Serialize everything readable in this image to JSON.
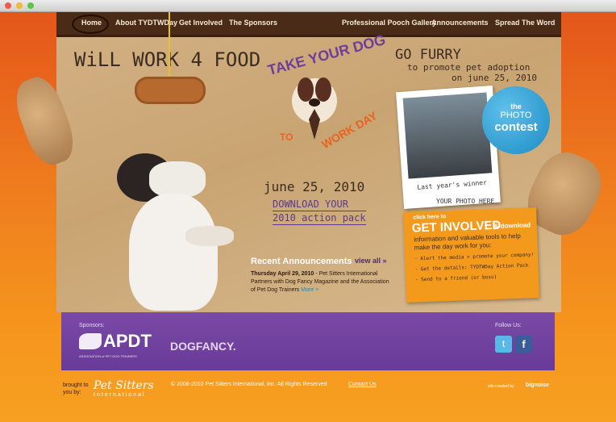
{
  "nav": {
    "items": [
      "Home",
      "About TYDTWDay",
      "Get Involved",
      "The Sponsors",
      "Professional Pooch Gallery",
      "Announcements",
      "Spread The Word"
    ]
  },
  "logo": {
    "line1": "TAKE YOUR DOG",
    "line2": "TO",
    "line3": "WORK DAY"
  },
  "headline_left": "WiLL WORK 4 FOOD",
  "headline_right": {
    "title": "GO FURRY",
    "line1": "to promote pet adoption",
    "line2": "on june 25, 2010"
  },
  "center": {
    "date": "june 25, 2010",
    "download_line1": "DOWNLOAD YOUR",
    "download_line2": "2010 action pack"
  },
  "photo": {
    "caption": "Last year's winner",
    "below": "YOUR PHOTO HERE",
    "badge_the": "the",
    "badge_photo": "PHOTO",
    "badge_contest": "contest"
  },
  "involved": {
    "click": "click here to",
    "title": "GET INVOLVED",
    "download": "& download",
    "text": "information and valuable tools to help make the day work for you:",
    "bullets": [
      "- Alert the media + promote your company!",
      "- Get the details: TYDTWDay Action Pack",
      "- Send to a friend (or boss)"
    ]
  },
  "announcements": {
    "heading": "Recent Announcements",
    "view_all": "view all »",
    "date": "Thursday April 29, 2010",
    "body": " - Pet Sitters International Partners with Dog Fancy Magazine and the Association of Pet Dog Trainers",
    "more": "More >"
  },
  "sponsors": {
    "label": "Sponsors:",
    "apdt": "APDT",
    "apdt_sub": "ASSOCIATION of PET DOG TRAINERS",
    "dogfancy": "DOGFANCY.",
    "follow": "Follow Us:"
  },
  "footer": {
    "brought": "brought to you by:",
    "psi_line1": "Pet Sitters",
    "psi_line2": "International",
    "copyright": "© 2008-2010 Pet Sitters International, Inc. All Rights Reserved",
    "contact": "Contact Us",
    "site_created": "site created by",
    "bignoise": "bignoise"
  },
  "colors": {
    "orange": "#f08a1c",
    "purple": "#6a3a99",
    "brown": "#4a2b17",
    "cardboard": "#c9a473",
    "blue": "#1b8bc4"
  }
}
